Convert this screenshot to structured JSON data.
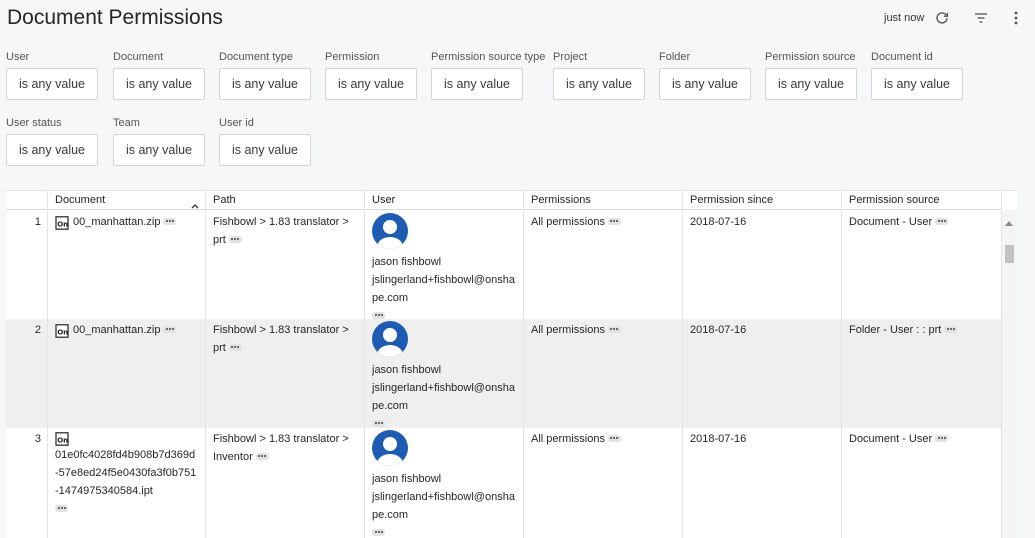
{
  "header": {
    "title": "Document Permissions",
    "timestamp": "just now"
  },
  "filters": [
    {
      "label": "User",
      "value": "is any value"
    },
    {
      "label": "Document",
      "value": "is any value"
    },
    {
      "label": "Document type",
      "value": "is any value"
    },
    {
      "label": "Permission",
      "value": "is any value"
    },
    {
      "label": "Permission source type",
      "value": "is any value"
    },
    {
      "label": "Project",
      "value": "is any value"
    },
    {
      "label": "Folder",
      "value": "is any value"
    },
    {
      "label": "Permission source",
      "value": "is any value"
    },
    {
      "label": "Document id",
      "value": "is any value"
    },
    {
      "label": "User status",
      "value": "is any value"
    },
    {
      "label": "Team",
      "value": "is any value"
    },
    {
      "label": "User id",
      "value": "is any value"
    }
  ],
  "table": {
    "columns": [
      "Document",
      "Path",
      "User",
      "Permissions",
      "Permission since",
      "Permission source"
    ],
    "rows": [
      {
        "num": "1",
        "document": "00_manhattan.zip",
        "path": "Fishbowl > 1.83 translator > prt",
        "user_name": "jason fishbowl",
        "user_email": "jslingerland+fishbowl@onshape.com",
        "permissions": "All permissions",
        "since": "2018-07-16",
        "source": "Document - User"
      },
      {
        "num": "2",
        "document": "00_manhattan.zip",
        "path": "Fishbowl > 1.83 translator > prt",
        "user_name": "jason fishbowl",
        "user_email": "jslingerland+fishbowl@onshape.com",
        "permissions": "All permissions",
        "since": "2018-07-16",
        "source": "Folder - User : : prt"
      },
      {
        "num": "3",
        "document": "01e0fc4028fd4b908b7d369d-57e8ed24f5e0430fa3f0b751-1474975340584.ipt",
        "path": "Fishbowl > 1.83 translator > Inventor",
        "user_name": "jason fishbowl",
        "user_email": "jslingerland+fishbowl@onshape.com",
        "permissions": "All permissions",
        "since": "2018-07-16",
        "source": "Document - User"
      }
    ]
  },
  "icons": {
    "refresh": "refresh-icon",
    "filter": "filter-icon",
    "more": "more-vertical-icon",
    "sort": "sort-ascending-icon",
    "document": "onshape-document-icon",
    "avatar": "user-avatar-icon"
  },
  "colors": {
    "avatar_blue": "#1e5cb3",
    "row_alt": "#efefef",
    "page_bg": "#f6f7f9"
  }
}
